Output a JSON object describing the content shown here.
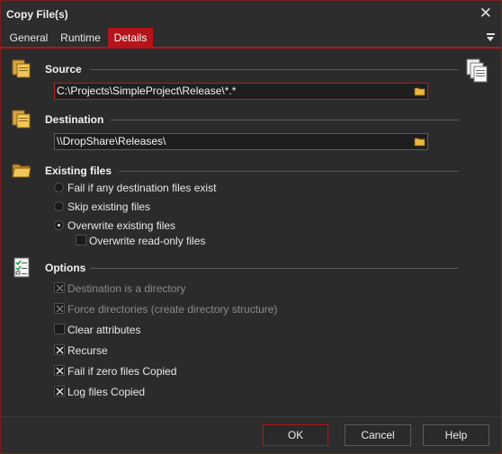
{
  "window": {
    "title": "Copy File(s)"
  },
  "tabs": [
    {
      "label": "General"
    },
    {
      "label": "Runtime"
    },
    {
      "label": "Details"
    }
  ],
  "source": {
    "title": "Source",
    "value": "C:\\Projects\\SimpleProject\\Release\\*.*"
  },
  "destination": {
    "title": "Destination",
    "value": "\\\\DropShare\\Releases\\"
  },
  "existing_files": {
    "title": "Existing files",
    "options": [
      {
        "label": "Fail if any destination files exist",
        "selected": false
      },
      {
        "label": "Skip existing files",
        "selected": false
      },
      {
        "label": "Overwrite existing files",
        "selected": true
      }
    ],
    "overwrite_readonly": {
      "label": "Overwrite read-only files",
      "checked": false
    }
  },
  "options": {
    "title": "Options",
    "items": [
      {
        "label": "Destination is a directory",
        "checked": true,
        "enabled": false
      },
      {
        "label": "Force directories (create directory structure)",
        "checked": true,
        "enabled": false
      },
      {
        "label": "Clear attributes",
        "checked": false,
        "enabled": true
      },
      {
        "label": "Recurse",
        "checked": true,
        "enabled": true
      },
      {
        "label": "Fail if zero files Copied",
        "checked": true,
        "enabled": true
      },
      {
        "label": "Log files Copied",
        "checked": true,
        "enabled": true
      }
    ]
  },
  "buttons": {
    "ok": "OK",
    "cancel": "Cancel",
    "help": "Help"
  },
  "icons": {
    "close": "close-icon",
    "menu": "dropdown-menu-icon",
    "source": "files-copy-icon",
    "destination": "files-copy-icon",
    "existing": "folder-icon",
    "options": "checklist-icon",
    "browse": "folder-browse-icon",
    "multi": "documents-icon"
  },
  "colors": {
    "accent": "#b4141a",
    "background": "#2b2b2b",
    "text": "#e8e8e8"
  }
}
